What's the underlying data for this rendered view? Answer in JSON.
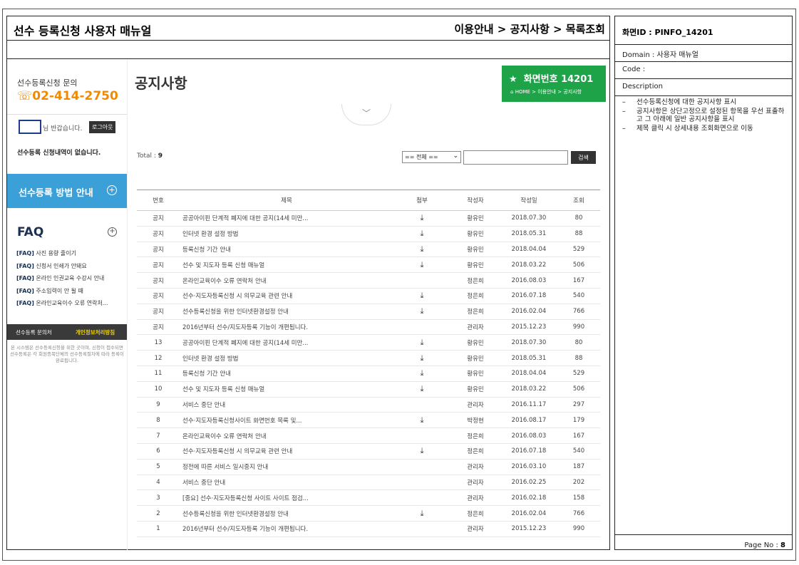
{
  "doc": {
    "title": "선수 등록신청 사용자 매뉴얼",
    "path": "이용안내 > 공지사항 > 목록조회"
  },
  "sidebar": {
    "contact_label": "선수등록신청 문의",
    "contact_phone": "02-414-2750",
    "user_greeting": "님 반갑습니다.",
    "logout_label": "로그아웃",
    "no_application": "선수등록 신청내역이 없습니다.",
    "guide_label": "선수등록 방법 안내",
    "faq_title": "FAQ",
    "faq_items": [
      {
        "tag": "[FAQ]",
        "text": "사진 용량 줄이기"
      },
      {
        "tag": "[FAQ]",
        "text": "신청서 인쇄가 안돼요"
      },
      {
        "tag": "[FAQ]",
        "text": "온라인 인권교육 수강시 안내"
      },
      {
        "tag": "[FAQ]",
        "text": "주소입력이 안 될 때"
      },
      {
        "tag": "[FAQ]",
        "text": "온라인교육이수 오류 연락처..."
      }
    ],
    "contact_bar_left": "선수등록 문의처",
    "contact_bar_right": "개인정보처리방침",
    "notice_small": "본 시스템은 선수등록신청을 위한 곳이며, 신청이 접수되면 선수등록은 각 회원종목단체의 선수등록절차에 따라 등록이 완료됩니다."
  },
  "main": {
    "page_title": "공지사항",
    "screen_no": "화면번호 14201",
    "screen_crumb": "HOME > 이용안내 > 공지사항",
    "total_label": "Total : ",
    "total_count": "9",
    "filter_value": "== 전체 ==",
    "search_label": "검색",
    "columns": [
      "번호",
      "제목",
      "첨부",
      "작성자",
      "작성일",
      "조회"
    ],
    "rows": [
      {
        "no": "공지",
        "title": "공공아이핀 단계적 폐지에 대한 공지(14세 미만...",
        "attach": true,
        "author": "황유민",
        "date": "2018.07.30",
        "views": "80"
      },
      {
        "no": "공지",
        "title": "인터넷 환경 설정 방법",
        "attach": true,
        "author": "황유민",
        "date": "2018.05.31",
        "views": "88"
      },
      {
        "no": "공지",
        "title": "등록신청 기간 안내",
        "attach": true,
        "author": "황유민",
        "date": "2018.04.04",
        "views": "529"
      },
      {
        "no": "공지",
        "title": "선수 및 지도자 등록 신청 매뉴얼",
        "attach": true,
        "author": "황유민",
        "date": "2018.03.22",
        "views": "506"
      },
      {
        "no": "공지",
        "title": "온라인교육이수 오류 연락처 안내",
        "attach": false,
        "author": "정은희",
        "date": "2016.08.03",
        "views": "167"
      },
      {
        "no": "공지",
        "title": "선수·지도자등록신청 시 의무교육 관련 안내",
        "attach": true,
        "author": "정은희",
        "date": "2016.07.18",
        "views": "540"
      },
      {
        "no": "공지",
        "title": "선수등록신청을 위한 인터넷환경설정 안내",
        "attach": true,
        "author": "정은희",
        "date": "2016.02.04",
        "views": "766"
      },
      {
        "no": "공지",
        "title": "2016년부터 선수/지도자등록 기능이 개편됩니다.",
        "attach": false,
        "author": "관리자",
        "date": "2015.12.23",
        "views": "990"
      },
      {
        "no": "13",
        "title": "공공아이핀 단계적 폐지에 대한 공지(14세 미만...",
        "attach": true,
        "author": "황유민",
        "date": "2018.07.30",
        "views": "80"
      },
      {
        "no": "12",
        "title": "인터넷 환경 설정 방법",
        "attach": true,
        "author": "황유민",
        "date": "2018.05.31",
        "views": "88"
      },
      {
        "no": "11",
        "title": "등록신청 기간 안내",
        "attach": true,
        "author": "황유민",
        "date": "2018.04.04",
        "views": "529"
      },
      {
        "no": "10",
        "title": "선수 및 지도자 등록 신청 매뉴얼",
        "attach": true,
        "author": "황유민",
        "date": "2018.03.22",
        "views": "506"
      },
      {
        "no": "9",
        "title": "서비스 중단 안내",
        "attach": false,
        "author": "관리자",
        "date": "2016.11.17",
        "views": "297"
      },
      {
        "no": "8",
        "title": "선수·지도자등록신청사이트 화면번호 목록 및...",
        "attach": true,
        "author": "박정현",
        "date": "2016.08.17",
        "views": "179"
      },
      {
        "no": "7",
        "title": "온라인교육이수 오류 연락처 안내",
        "attach": false,
        "author": "정은희",
        "date": "2016.08.03",
        "views": "167"
      },
      {
        "no": "6",
        "title": "선수·지도자등록신청 시 의무교육 관련 안내",
        "attach": true,
        "author": "정은희",
        "date": "2016.07.18",
        "views": "540"
      },
      {
        "no": "5",
        "title": "정전에 따른 서비스 일시중지 안내",
        "attach": false,
        "author": "관리자",
        "date": "2016.03.10",
        "views": "187"
      },
      {
        "no": "4",
        "title": "서비스 중단 안내",
        "attach": false,
        "author": "관리자",
        "date": "2016.02.25",
        "views": "202"
      },
      {
        "no": "3",
        "title": "[중요] 선수·지도자등록신청 사이트 사이트 점검...",
        "attach": false,
        "author": "관리자",
        "date": "2016.02.18",
        "views": "158"
      },
      {
        "no": "2",
        "title": "선수등록신청을 위한 인터넷환경설정 안내",
        "attach": true,
        "author": "정은희",
        "date": "2016.02.04",
        "views": "766"
      },
      {
        "no": "1",
        "title": "2016년부터 선수/지도자등록 기능이 개편됩니다.",
        "attach": false,
        "author": "관리자",
        "date": "2015.12.23",
        "views": "990"
      }
    ]
  },
  "spec": {
    "screen_id": "화면ID : PINFO_14201",
    "domain": "Domain : 사용자 매뉴얼",
    "code": "Code :",
    "description_label": "Description",
    "descriptions": [
      "선수등록신청에 대한 공지사항 표시",
      "공지사항은 상단고정으로 설정된 항목을 우선 표출하고 그 아래에 일반 공지사항을 표시",
      "제목 클릭 시 상세내용 조회화면으로 이동"
    ],
    "page_label": "Page No : ",
    "page_no": "8"
  },
  "colors": {
    "phone": "#f08a00",
    "guide_bar": "#3ca0d8",
    "screen_box": "#1fa349",
    "contact_bar": "#3a3a3a",
    "privacy_link": "#f5d400"
  }
}
